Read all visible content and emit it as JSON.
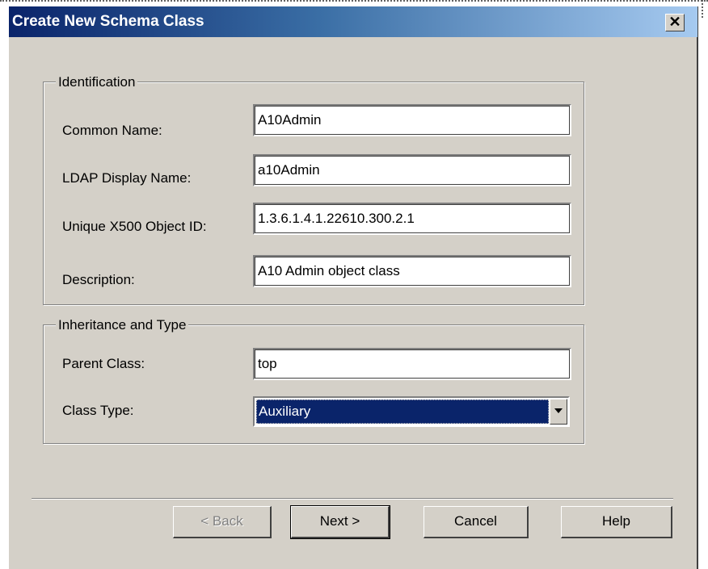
{
  "dialog": {
    "title": "Create New Schema Class",
    "close_glyph": "✕"
  },
  "identification": {
    "legend": "Identification",
    "common_name": {
      "label": "Common Name:",
      "value": "A10Admin"
    },
    "ldap_display_name": {
      "label": "LDAP Display Name:",
      "value": "a10Admin"
    },
    "x500_object_id": {
      "label": "Unique X500 Object ID:",
      "value": "1.3.6.1.4.1.22610.300.2.1"
    },
    "description": {
      "label": "Description:",
      "value": "A10 Admin object class"
    }
  },
  "inheritance": {
    "legend": "Inheritance and Type",
    "parent_class": {
      "label": "Parent Class:",
      "value": "top"
    },
    "class_type": {
      "label": "Class Type:",
      "value": "Auxiliary"
    }
  },
  "buttons": {
    "back": "< Back",
    "next": "Next >",
    "cancel": "Cancel",
    "help": "Help"
  },
  "icons": {
    "close": "close-icon",
    "dropdown": "chevron-down-icon"
  }
}
